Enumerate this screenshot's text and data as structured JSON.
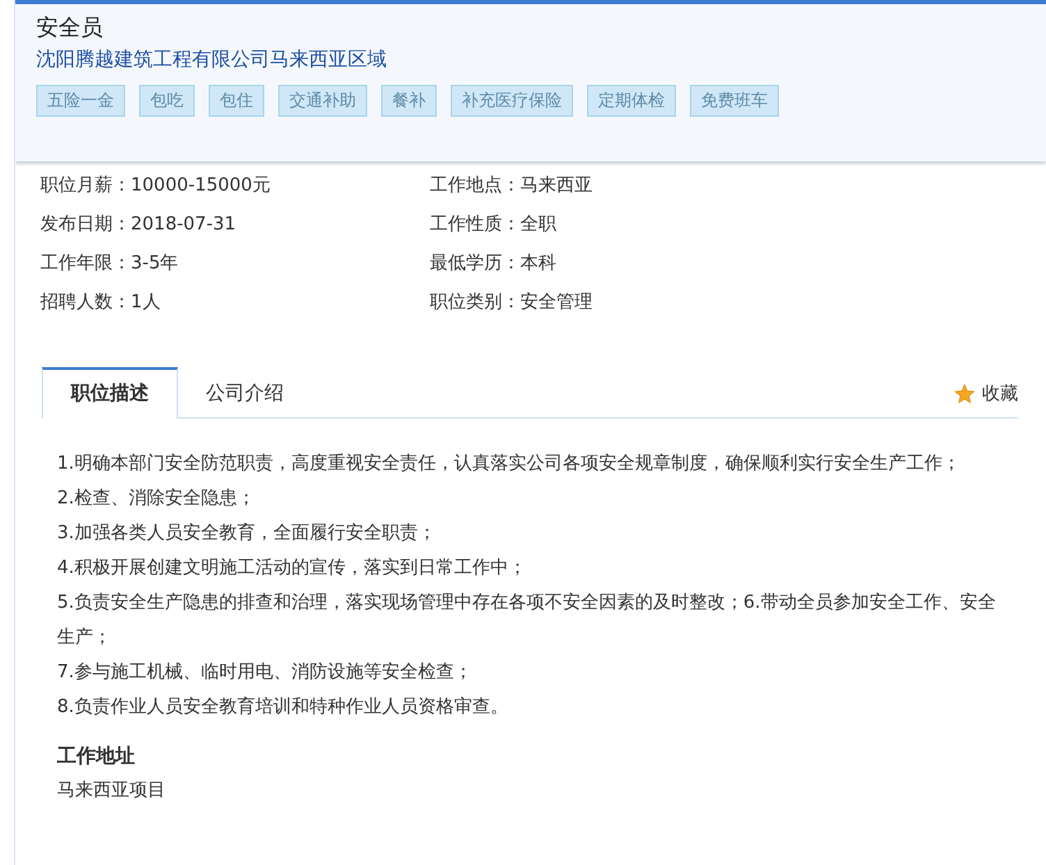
{
  "header": {
    "title": "安全员",
    "company": "沈阳腾越建筑工程有限公司马来西亚区域",
    "tags": [
      "五险一金",
      "包吃",
      "包住",
      "交通补助",
      "餐补",
      "补充医疗保险",
      "定期体检",
      "免费班车"
    ]
  },
  "info": [
    {
      "text": "职位月薪：10000-15000元"
    },
    {
      "text": "工作地点：马来西亚"
    },
    {
      "text": "发布日期：2018-07-31"
    },
    {
      "text": "工作性质：全职"
    },
    {
      "text": "工作年限：3-5年"
    },
    {
      "text": "最低学历：本科"
    },
    {
      "text": "招聘人数：1人"
    },
    {
      "text": "职位类别：安全管理"
    }
  ],
  "tabs": [
    {
      "label": "职位描述",
      "selected": true
    },
    {
      "label": "公司介绍",
      "selected": false
    }
  ],
  "favorite": {
    "label": "收藏"
  },
  "description": [
    "1.明确本部门安全防范职责，高度重视安全责任，认真落实公司各项安全规章制度，确保顺利实行安全生产工作；",
    "2.检查、消除安全隐患；",
    "3.加强各类人员安全教育，全面履行安全职责；",
    "4.积极开展创建文明施工活动的宣传，落实到日常工作中；",
    "5.负责安全生产隐患的排查和治理，落实现场管理中存在各项不安全因素的及时整改；6.带动全员参加安全工作、安全生产；",
    "7.参与施工机械、临时用电、消防设施等安全检查；",
    "8.负责作业人员安全教育培训和特种作业人员资格审查。"
  ],
  "address": {
    "heading": "工作地址",
    "value": "马来西亚项目"
  }
}
